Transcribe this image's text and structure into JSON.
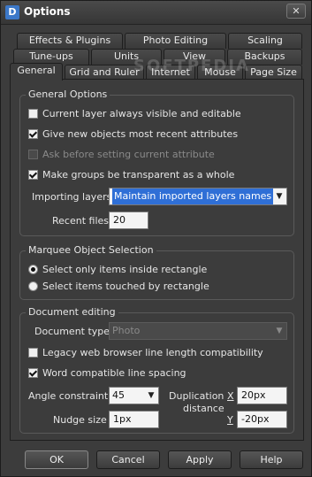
{
  "window": {
    "title": "Options",
    "app_icon": "D",
    "close": "✕"
  },
  "watermark": "SOFTPEDIA",
  "tabs": {
    "row1": [
      "Effects & Plugins",
      "Photo Editing",
      "Scaling"
    ],
    "row2": [
      "Tune-ups",
      "Units",
      "View",
      "Backups"
    ],
    "row3": [
      "General",
      "Grid and Ruler",
      "Internet",
      "Mouse",
      "Page Size"
    ]
  },
  "general_options": {
    "title": "General Options",
    "current_layer": "Current layer always visible and editable",
    "give_new_objects": "Give new objects most recent attributes",
    "ask_before": "Ask before setting current attribute",
    "make_groups": "Make groups be transparent as a whole",
    "importing_layers_label": "Importing layers",
    "importing_layers_value": "Maintain imported layers names",
    "recent_files_label": "Recent files",
    "recent_files_value": "20"
  },
  "marquee": {
    "title": "Marquee Object Selection",
    "option_inside": "Select only items inside rectangle",
    "option_touched": "Select items touched by rectangle"
  },
  "document_editing": {
    "title": "Document editing",
    "document_type_label": "Document type",
    "document_type_value": "Photo",
    "legacy_web": "Legacy web browser line length compatibility",
    "word_compatible": "Word compatible line spacing",
    "angle_label": "Angle constraint",
    "angle_value": "45",
    "nudge_label": "Nudge size",
    "nudge_value": "1px",
    "duplication_label_1": "Duplication",
    "duplication_label_2": "distance",
    "x_label": "X",
    "x_value": "20px",
    "y_label": "Y",
    "y_value": "-20px"
  },
  "buttons": {
    "ok": "OK",
    "cancel": "Cancel",
    "apply": "Apply",
    "help": "Help"
  }
}
